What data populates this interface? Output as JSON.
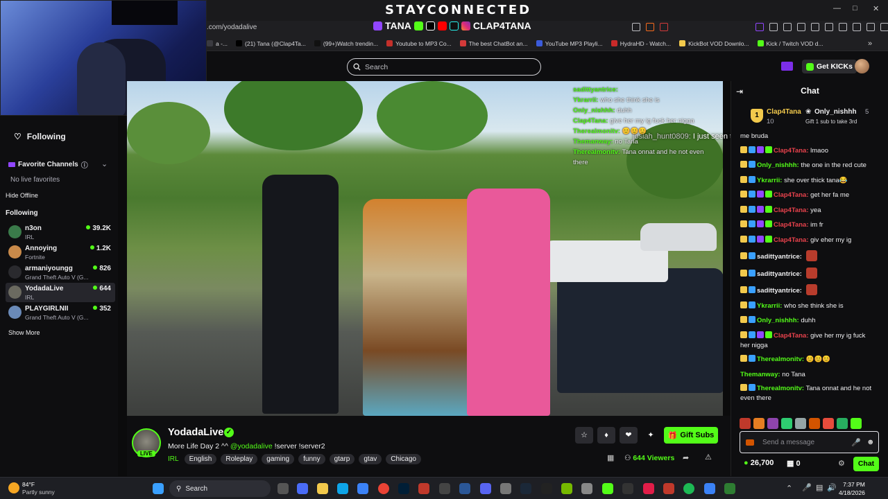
{
  "overlay": {
    "brand": "STAYCONNECTED",
    "handle_1": "TANA",
    "handle_2": "CLAP4TANA"
  },
  "browser": {
    "url": ".com/yodadalive",
    "bookmarks": [
      {
        "label": "a -...",
        "color": "#3a3a40"
      },
      {
        "label": "(21) Tana (@Clap4Ta...",
        "color": "#000000"
      },
      {
        "label": "(99+)Watch trendin...",
        "color": "#111111"
      },
      {
        "label": "Youtube to MP3 Co...",
        "color": "#c4302b"
      },
      {
        "label": "The best ChatBot an...",
        "color": "#d33a3a"
      },
      {
        "label": "YouTube MP3 Playli...",
        "color": "#3b5bdb"
      },
      {
        "label": "HydraHD - Watch...",
        "color": "#c92a2a"
      },
      {
        "label": "KickBot VOD Downlo...",
        "color": "#f2c94c"
      },
      {
        "label": "Kick / Twitch VOD d...",
        "color": "#53fc18"
      }
    ]
  },
  "header": {
    "search_placeholder": "Search",
    "get_kicks": "Get KICKs"
  },
  "sidebar": {
    "following_nav": "Following",
    "favorites_title": "Favorite Channels",
    "no_favorites": "No live favorites",
    "hide_offline": "Hide Offline",
    "following_title": "Following",
    "channels": [
      {
        "name": "n3on",
        "category": "IRL",
        "viewers": "39.2K",
        "color": "#3a7a4a"
      },
      {
        "name": "Annoying",
        "category": "Fortnite",
        "viewers": "1.2K",
        "color": "#c98a4a"
      },
      {
        "name": "armaniyoungg",
        "category": "Grand Theft Auto V (G...",
        "viewers": "826",
        "color": "#2a2a2e"
      },
      {
        "name": "YodadaLive",
        "category": "IRL",
        "viewers": "644",
        "color": "#6b6a60"
      },
      {
        "name": "PLAYGIRLNII",
        "category": "Grand Theft Auto V (G...",
        "viewers": "352",
        "color": "#6a8ab8"
      }
    ],
    "show_more": "Show More"
  },
  "video_chat": [
    {
      "user": "sadittyantrice:",
      "text": ""
    },
    {
      "user": "Ykrarrii:",
      "text": "who she think she is"
    },
    {
      "user": "Only_nishhh:",
      "text": "duhh"
    },
    {
      "user": "Clap4Tana:",
      "text": "give her my ig fuck her nigga"
    },
    {
      "user": "Therealmonitv:",
      "text": "😊😊😊"
    },
    {
      "user": "Themanway:",
      "text": "no Tana"
    },
    {
      "user": "Therealmonitv:",
      "text": "Tana onnat and he not even there"
    }
  ],
  "video_overlay_msg": {
    "user": "josiah_hunt0809:",
    "text": "I just seen that"
  },
  "stream": {
    "name": "YodadaLive",
    "live": "LIVE",
    "title_prefix": "More Life Day 2 ^^",
    "mention": "@yodadalive",
    "title_suffix": "!server !server2",
    "category": "IRL",
    "tags": [
      "English",
      "Roleplay",
      "gaming",
      "funny",
      "gtarp",
      "gtav",
      "Chicago"
    ],
    "gift_subs": "Gift Subs",
    "viewer_count": "644",
    "viewers_label": "Viewers"
  },
  "chat": {
    "title": "Chat",
    "pinned": {
      "rank": "1",
      "user_1": "Clap4Tana",
      "count_1": "10",
      "user_2": "Only_nishhh",
      "count_2": "5",
      "cta": "Gift 1 sub to take 3rd"
    },
    "messages": [
      {
        "user": "",
        "color": "#efeff1",
        "text": "me bruda"
      },
      {
        "user": "Clap4Tana:",
        "color": "#e8424c",
        "text": "lmaoo"
      },
      {
        "user": "Only_nishhh:",
        "color": "#53fc18",
        "text": "the one in the red cute"
      },
      {
        "user": "Ykrarrii:",
        "color": "#53fc18",
        "text": "she over thick tana😂"
      },
      {
        "user": "Clap4Tana:",
        "color": "#e8424c",
        "text": "get her fa me"
      },
      {
        "user": "Clap4Tana:",
        "color": "#e8424c",
        "text": "yea"
      },
      {
        "user": "Clap4Tana:",
        "color": "#e8424c",
        "text": "im fr"
      },
      {
        "user": "Clap4Tana:",
        "color": "#e8424c",
        "text": "giv eher my ig"
      },
      {
        "user": "sadittyantrice:",
        "color": "#efeff1",
        "text": ""
      },
      {
        "user": "sadittyantrice:",
        "color": "#efeff1",
        "text": ""
      },
      {
        "user": "sadittyantrice:",
        "color": "#efeff1",
        "text": ""
      },
      {
        "user": "Ykrarrii:",
        "color": "#53fc18",
        "text": "who she think she is"
      },
      {
        "user": "Only_nishhh:",
        "color": "#53fc18",
        "text": "duhh"
      },
      {
        "user": "Clap4Tana:",
        "color": "#e8424c",
        "text": "give her my ig fuck her nigga"
      },
      {
        "user": "Therealmonitv:",
        "color": "#53fc18",
        "text": "😊😊😊"
      },
      {
        "user": "Themanway:",
        "color": "#53fc18",
        "text": "no Tana"
      },
      {
        "user": "Therealmonitv:",
        "color": "#53fc18",
        "text": "Tana onnat and he not even there"
      }
    ],
    "input_placeholder": "Send a message",
    "points": "26,700",
    "points_2": "0",
    "send_label": "Chat"
  },
  "taskbar": {
    "temp": "84°F",
    "condition": "Partly sunny",
    "search": "Search",
    "time": "7:37 PM",
    "date": "4/18/2026"
  }
}
